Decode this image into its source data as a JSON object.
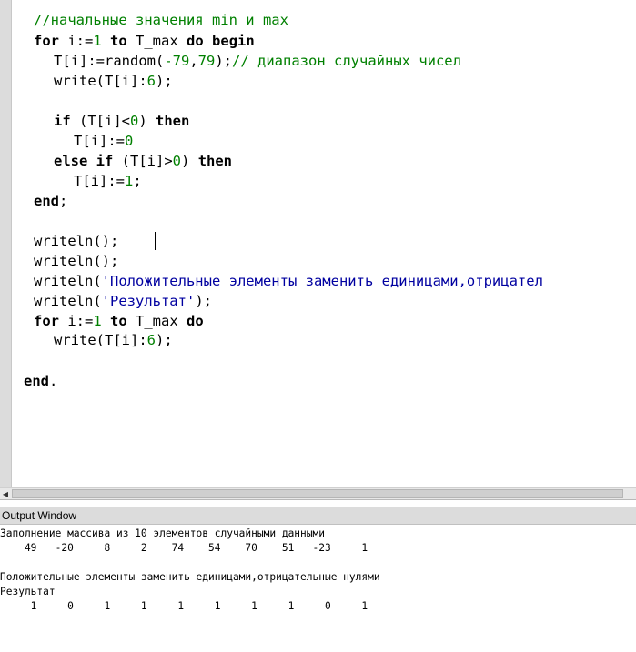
{
  "editor": {
    "line1_comment": "//начальные значения min и max",
    "line2": {
      "kw_for": "for",
      "var": " i:=",
      "num": "1",
      "kw_to": "to",
      "bound": " T_max ",
      "kw_do": "do",
      "kw_begin": "begin"
    },
    "line3": {
      "code_a": "T[i]:=random(",
      "num_a": "-79",
      "comma": ",",
      "num_b": "79",
      "code_b": ");",
      "comment": "// диапазон случайных чисел"
    },
    "line4": {
      "code_a": "write(T[i]:",
      "num": "6",
      "code_b": ");"
    },
    "line5": {
      "kw_if": "if",
      "code_a": " (T[i]<",
      "num": "0",
      "code_b": ") ",
      "kw_then": "then"
    },
    "line6": {
      "code_a": "T[i]:=",
      "num": "0"
    },
    "line7": {
      "kw_else": "else",
      "kw_if": "if",
      "code_a": " (T[i]>",
      "num": "0",
      "code_b": ") ",
      "kw_then": "then"
    },
    "line8": {
      "code_a": "T[i]:=",
      "num": "1",
      "code_b": ";"
    },
    "line9": {
      "kw_end": "end",
      "code": ";"
    },
    "line10": "writeln();",
    "line11": "writeln();",
    "line12": {
      "code_a": "writeln(",
      "str": "'Положительные элементы заменить единицами,отрицател"
    },
    "line13": {
      "code_a": "writeln(",
      "str": "'Результат'",
      "code_b": ");"
    },
    "line14": {
      "kw_for": "for",
      "var": " i:=",
      "num": "1",
      "kw_to": "to",
      "bound": " T_max ",
      "kw_do": "do"
    },
    "line15": {
      "code_a": "write(T[i]:",
      "num": "6",
      "code_b": ");"
    },
    "line16": {
      "kw_end": "end",
      "code": "."
    }
  },
  "scrollbar": {
    "left_arrow": "◀"
  },
  "output_window": {
    "title": "Output Window",
    "lines": [
      "Заполнение массива из 10 элементов случайными данными",
      "    49   -20     8     2    74    54    70    51   -23     1",
      "",
      "Положительные элементы заменить единицами,отрицательные нулями",
      "Результат",
      "     1     0     1     1     1     1     1     1     0     1"
    ]
  }
}
